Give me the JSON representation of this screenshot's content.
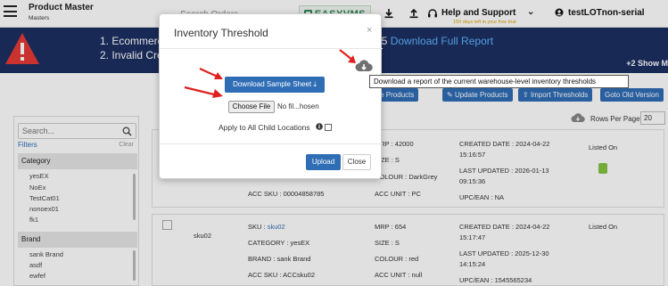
{
  "header": {
    "app_title": "Product Master",
    "app_subtitle": "Masters",
    "search_placeholder": "Search Orders",
    "logo_text": "EASYVMS",
    "help_label": "Help and Support",
    "trial_text": "150 days left in your free trial",
    "user_name": "testLOTnon-serial"
  },
  "banner": {
    "line1": "1. Ecommerc",
    "line2": "2. Invalid Cre",
    "right_prefix": "25 ",
    "right_link": "Download Full Report",
    "show_more": "+2 Show M"
  },
  "toolbar": {
    "buttons": [
      "eate Products",
      "Update Products",
      "Import Thresholds",
      "Goto Old Version"
    ],
    "rows_per_page_label": "Rows Per Page",
    "rows_per_page_value": "20"
  },
  "sidebar": {
    "search_placeholder": "Search...",
    "filters_label": "Filters",
    "clear_label": "Clear",
    "category_label": "Category",
    "category_items": [
      "yesEX",
      "NoEx",
      "TestCat01",
      "nonoex01",
      "fk1"
    ],
    "brand_label": "Brand",
    "brand_items": [
      "sank Brand",
      "asdf",
      "ewfef"
    ]
  },
  "rows": [
    {
      "sku_label": "",
      "acc_sku": "ACC SKU : 00004858785",
      "mrp": "MRP : 42000",
      "size": "SIZE : S",
      "colour": "COLOUR : DarkGrey",
      "acc_unit": "ACC UNIT : PC",
      "created": "CREATED DATE : 2024-04-22",
      "created_time": "15:16:57",
      "updated": "LAST UPDATED : 2026-01-13",
      "updated_time": "09:15:36",
      "upc": "UPC/EAN : NA",
      "listed_on": "Listed On"
    },
    {
      "sku_label": "sku02",
      "sku": "SKU : ",
      "sku_value": "sku02",
      "category": "CATEGORY : yesEX",
      "brand": "BRAND : sank Brand",
      "acc_sku": "ACC SKU : ACCsku02",
      "mrp": "MRP : 654",
      "size": "SIZE : S",
      "colour": "COLOUR : red",
      "acc_unit": "ACC UNIT : null",
      "created": "CREATED DATE : 2024-04-22",
      "created_time": "15:17:47",
      "updated": "LAST UPDATED : 2025-12-30",
      "updated_time": "14:15:24",
      "upc": "UPC/EAN : 1545565234",
      "listed_on": "Listed On"
    }
  ],
  "modal": {
    "title": "Inventory Threshold",
    "close_symbol": "×",
    "download_sample_label": "Download Sample Sheet",
    "choose_file_label": "Choose File",
    "file_status": "No fil...hosen",
    "apply_label": "Apply to All Child Locations",
    "apply_checked": false,
    "upload_label": "Upload",
    "close_label": "Close"
  },
  "tooltip": {
    "text": "Download a report of the current warehouse-level inventory thresholds"
  },
  "colors": {
    "primary": "#2f6db5",
    "banner_bg": "#1c2f62",
    "arrow": "#e02020",
    "trial": "#d9a300",
    "logo": "#2e8b57"
  }
}
